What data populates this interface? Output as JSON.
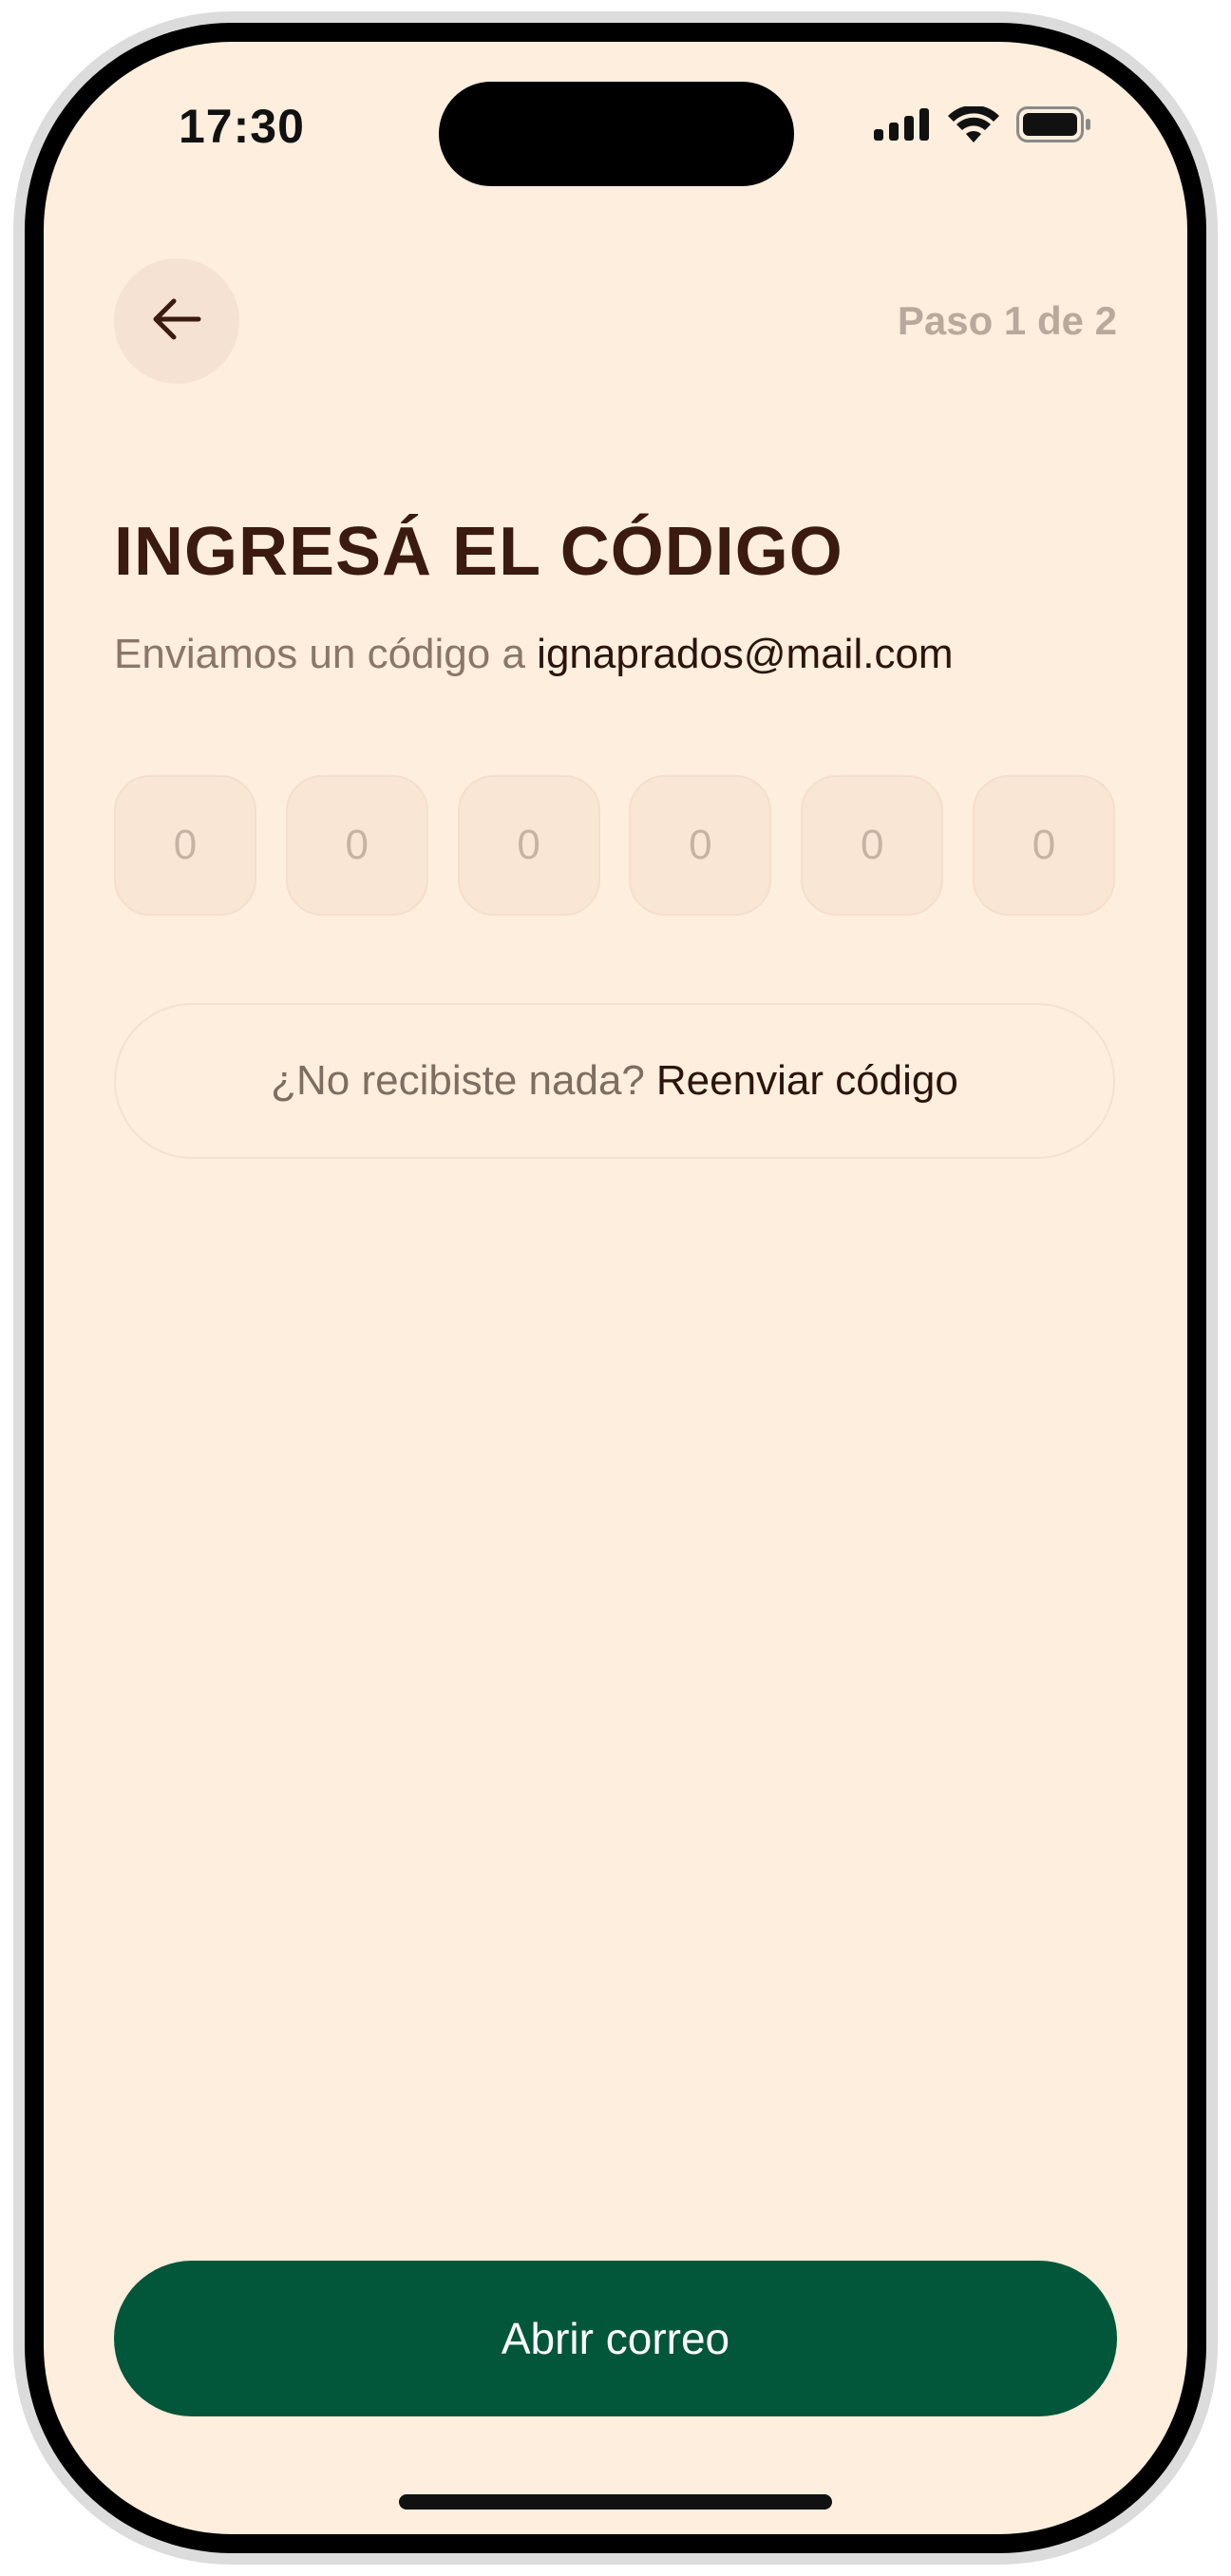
{
  "status_bar": {
    "time": "17:30",
    "icons": [
      "cellular-signal-icon",
      "wifi-icon",
      "battery-icon"
    ]
  },
  "header": {
    "back_icon": "arrow-left-icon",
    "step": "Paso 1 de 2"
  },
  "main": {
    "title": "INGRESÁ EL CÓDIGO",
    "subtitle_prefix": "Enviamos un código a",
    "email": "ignaprados@mail.com",
    "code_digits": [
      "0",
      "0",
      "0",
      "0",
      "0",
      "0"
    ],
    "resend_prompt": "¿No recibiste nada?",
    "resend_link": "Reenviar código"
  },
  "footer": {
    "cta_label": "Abrir correo"
  },
  "colors": {
    "background": "#fdeedd",
    "title": "#3b1a0f",
    "cta": "#02563a",
    "muted": "#b8a99c"
  }
}
